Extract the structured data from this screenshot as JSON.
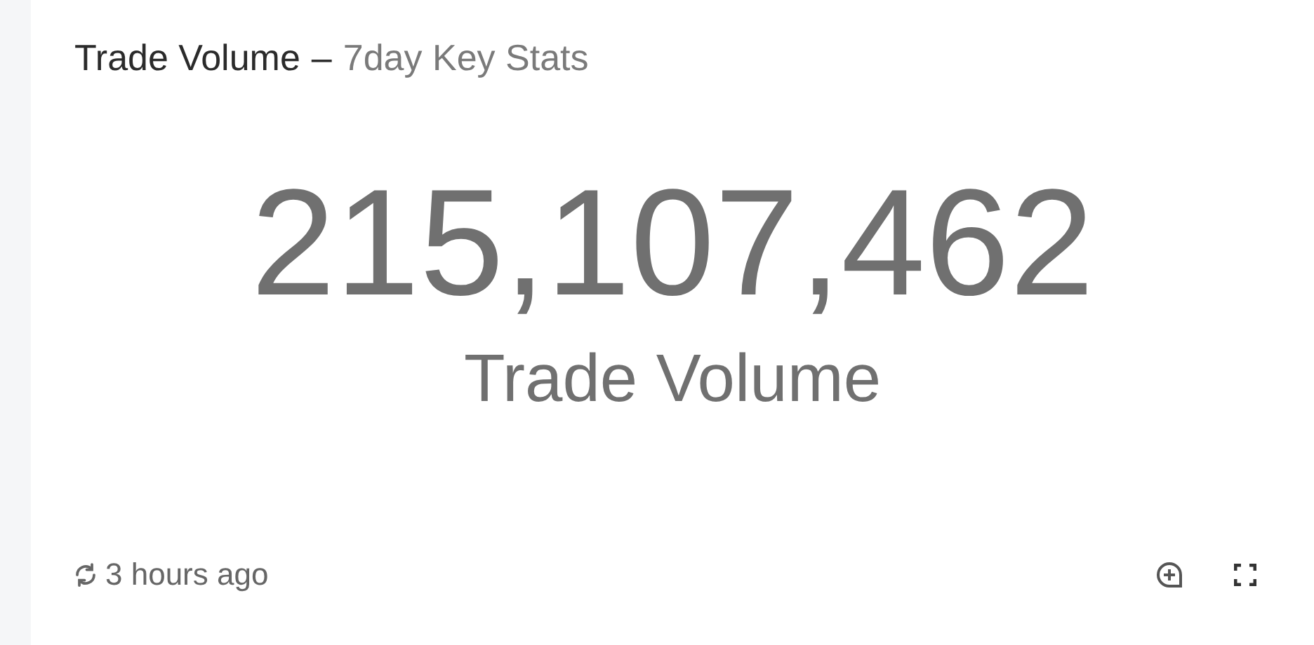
{
  "card": {
    "title": "Trade Volume",
    "separator": "–",
    "subtitle": "7day Key Stats",
    "value": "215,107,462",
    "label": "Trade Volume",
    "updated": "3 hours ago"
  }
}
